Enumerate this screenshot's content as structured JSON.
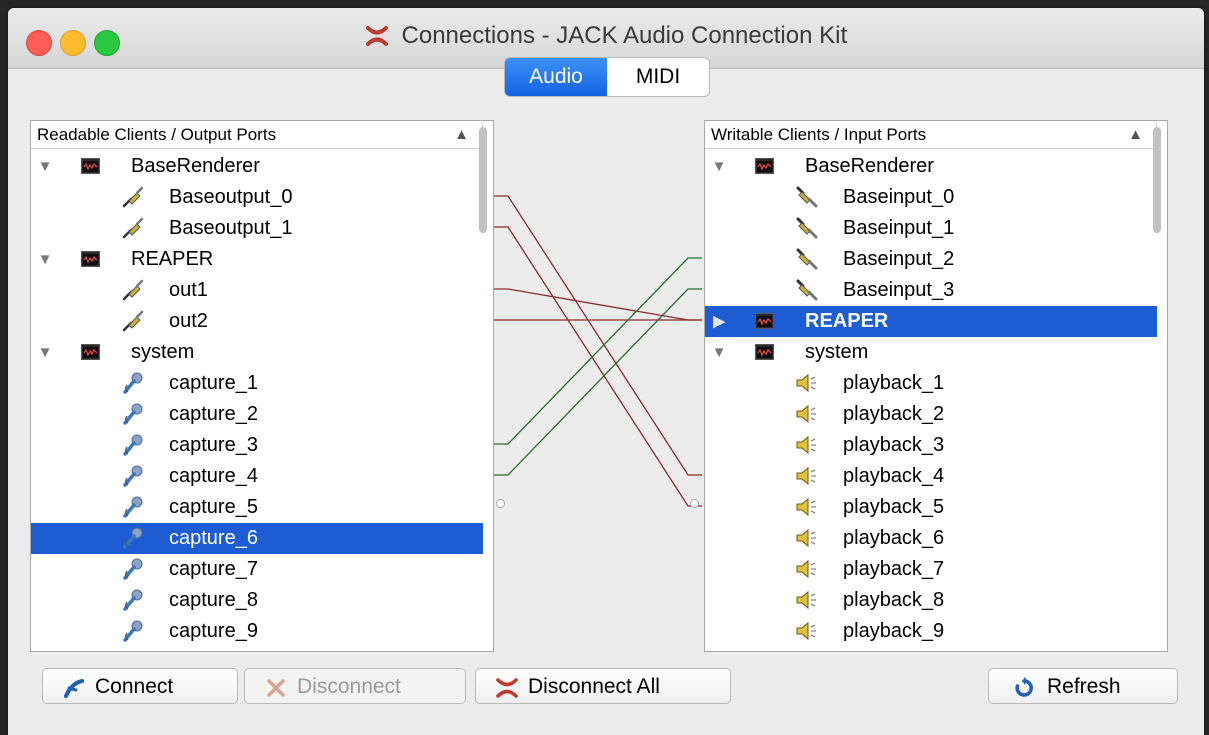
{
  "window": {
    "title": "Connections - JACK Audio Connection Kit"
  },
  "tabs": [
    {
      "label": "Audio",
      "active": true
    },
    {
      "label": "MIDI",
      "active": false
    }
  ],
  "left_panel": {
    "header": "Readable Clients / Output Ports",
    "rows": [
      {
        "type": "client",
        "label": "BaseRenderer",
        "expanded": true
      },
      {
        "type": "port",
        "label": "Baseoutput_0",
        "icon": "plug-icon"
      },
      {
        "type": "port",
        "label": "Baseoutput_1",
        "icon": "plug-icon"
      },
      {
        "type": "client",
        "label": "REAPER",
        "expanded": true
      },
      {
        "type": "port",
        "label": "out1",
        "icon": "plug-icon"
      },
      {
        "type": "port",
        "label": "out2",
        "icon": "plug-icon"
      },
      {
        "type": "client",
        "label": "system",
        "expanded": true
      },
      {
        "type": "port",
        "label": "capture_1",
        "icon": "microphone-icon"
      },
      {
        "type": "port",
        "label": "capture_2",
        "icon": "microphone-icon"
      },
      {
        "type": "port",
        "label": "capture_3",
        "icon": "microphone-icon"
      },
      {
        "type": "port",
        "label": "capture_4",
        "icon": "microphone-icon"
      },
      {
        "type": "port",
        "label": "capture_5",
        "icon": "microphone-icon"
      },
      {
        "type": "port",
        "label": "capture_6",
        "icon": "microphone-icon",
        "selected": true
      },
      {
        "type": "port",
        "label": "capture_7",
        "icon": "microphone-icon"
      },
      {
        "type": "port",
        "label": "capture_8",
        "icon": "microphone-icon"
      },
      {
        "type": "port",
        "label": "capture_9",
        "icon": "microphone-icon"
      }
    ]
  },
  "right_panel": {
    "header": "Writable Clients / Input Ports",
    "rows": [
      {
        "type": "client",
        "label": "BaseRenderer",
        "expanded": true
      },
      {
        "type": "port",
        "label": "Baseinput_0",
        "icon": "jack-plug-icon"
      },
      {
        "type": "port",
        "label": "Baseinput_1",
        "icon": "jack-plug-icon"
      },
      {
        "type": "port",
        "label": "Baseinput_2",
        "icon": "jack-plug-icon"
      },
      {
        "type": "port",
        "label": "Baseinput_3",
        "icon": "jack-plug-icon"
      },
      {
        "type": "client",
        "label": "REAPER",
        "expanded": false,
        "selected": true,
        "bold": true
      },
      {
        "type": "client",
        "label": "system",
        "expanded": true
      },
      {
        "type": "port",
        "label": "playback_1",
        "icon": "speaker-icon"
      },
      {
        "type": "port",
        "label": "playback_2",
        "icon": "speaker-icon"
      },
      {
        "type": "port",
        "label": "playback_3",
        "icon": "speaker-icon"
      },
      {
        "type": "port",
        "label": "playback_4",
        "icon": "speaker-icon"
      },
      {
        "type": "port",
        "label": "playback_5",
        "icon": "speaker-icon"
      },
      {
        "type": "port",
        "label": "playback_6",
        "icon": "speaker-icon"
      },
      {
        "type": "port",
        "label": "playback_7",
        "icon": "speaker-icon"
      },
      {
        "type": "port",
        "label": "playback_8",
        "icon": "speaker-icon"
      },
      {
        "type": "port",
        "label": "playback_9",
        "icon": "speaker-icon"
      }
    ]
  },
  "connections": [
    {
      "from": "Baseoutput_0",
      "to": "playback_4",
      "color": "#8b2a2a"
    },
    {
      "from": "Baseoutput_1",
      "to": "playback_5",
      "color": "#8b2a2a"
    },
    {
      "from": "out1",
      "to": "REAPER",
      "color": "#8b2a2a"
    },
    {
      "from": "out2",
      "to": "REAPER",
      "color": "#8b2a2a"
    },
    {
      "from": "capture_3",
      "to": "Baseinput_2",
      "color": "#2a6b2a"
    },
    {
      "from": "capture_4",
      "to": "Baseinput_3",
      "color": "#2a6b2a"
    }
  ],
  "buttons": {
    "connect": "Connect",
    "disconnect": "Disconnect",
    "disconnect_all": "Disconnect All",
    "refresh": "Refresh"
  },
  "colors": {
    "selection": "#1e5cd3",
    "audio_connection": "#8b2a2a",
    "midi_connection": "#2a6b2a"
  }
}
